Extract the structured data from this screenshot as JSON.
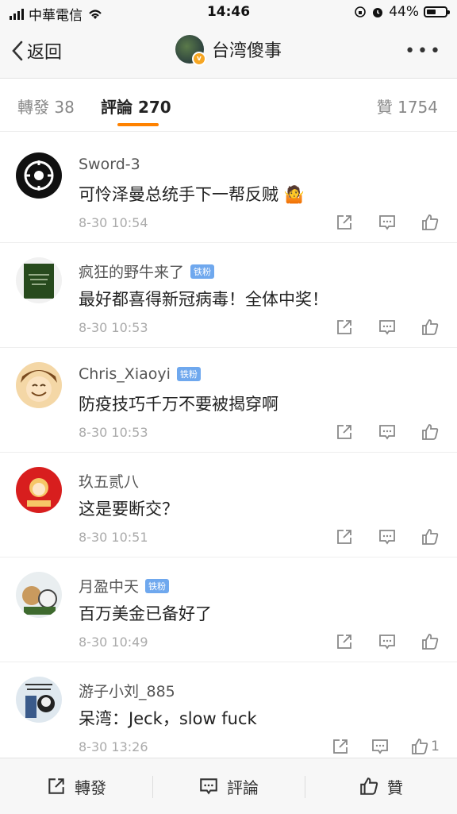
{
  "status": {
    "carrier": "中華電信",
    "time": "14:46",
    "battery": "44%"
  },
  "nav": {
    "back_label": "返回",
    "title": "台湾傻事",
    "more": "•••"
  },
  "tabs": {
    "repost": "轉發 38",
    "comments": "評論 270",
    "likes": "贊 1754"
  },
  "comments": [
    {
      "name": "Sword-3",
      "badge": "",
      "text": "可怜泽曼总统手下一帮反贼 🤷",
      "time": "8-30 10:54",
      "likes": ""
    },
    {
      "name": "疯狂的野牛来了",
      "badge": "铁粉",
      "text": "最好都喜得新冠病毒！全体中奖！",
      "time": "8-30 10:53",
      "likes": ""
    },
    {
      "name": "Chris_Xiaoyi",
      "badge": "铁粉",
      "text": "防疫技巧千万不要被揭穿啊",
      "time": "8-30 10:53",
      "likes": ""
    },
    {
      "name": "玖五贰八",
      "badge": "",
      "text": "这是要断交？",
      "time": "8-30 10:51",
      "likes": ""
    },
    {
      "name": "月盈中天",
      "badge": "铁粉",
      "text": "百万美金已备好了",
      "time": "8-30 10:49",
      "likes": ""
    },
    {
      "name": "游子小刘_885",
      "badge": "",
      "text": "呆湾：Jeck，slow fuck",
      "time": "8-30 13:26",
      "likes": "1"
    }
  ],
  "bottom": {
    "repost": "轉發",
    "comment": "評論",
    "like": "贊"
  },
  "colors": {
    "accent": "#ff8200",
    "badge": "#6fa8ee"
  }
}
